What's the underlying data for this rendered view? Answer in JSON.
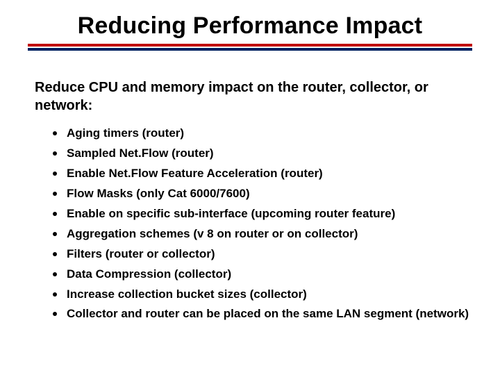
{
  "title": "Reducing Performance Impact",
  "intro": "Reduce CPU and memory impact on the router, collector, or network:",
  "bullets": [
    "Aging timers (router)",
    "Sampled Net.Flow (router)",
    "Enable Net.Flow Feature Acceleration (router)",
    "Flow Masks (only Cat 6000/7600)",
    "Enable on specific sub-interface (upcoming router feature)",
    "Aggregation schemes (v 8 on router or on collector)",
    "Filters (router or collector)",
    "Data Compression (collector)",
    "Increase collection bucket sizes (collector)",
    "Collector and router can be placed on the same LAN segment (network)"
  ]
}
